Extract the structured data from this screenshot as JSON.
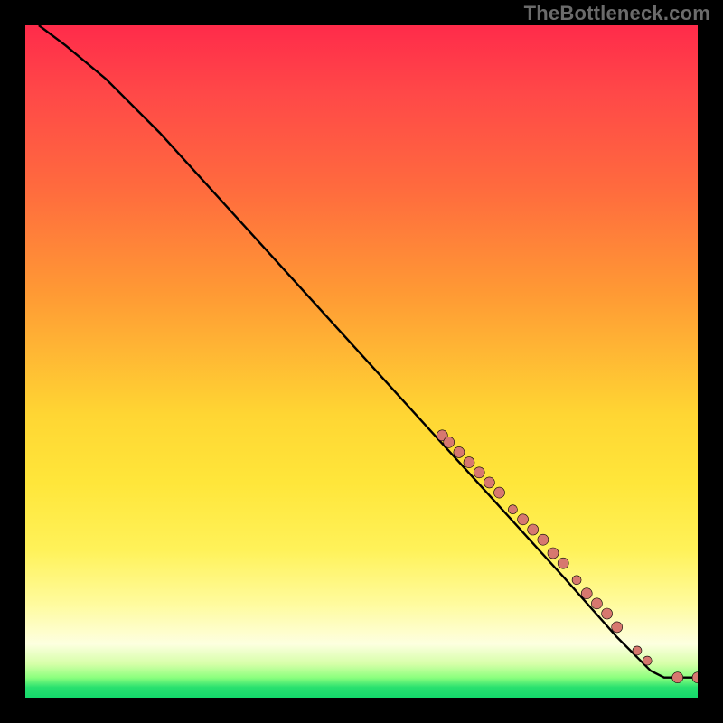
{
  "watermark": "TheBottleneck.com",
  "chart_data": {
    "type": "line",
    "title": "",
    "xlabel": "",
    "ylabel": "",
    "xlim": [
      0,
      100
    ],
    "ylim": [
      0,
      100
    ],
    "curve": [
      {
        "x": 2,
        "y": 100
      },
      {
        "x": 6,
        "y": 97
      },
      {
        "x": 12,
        "y": 92
      },
      {
        "x": 20,
        "y": 84
      },
      {
        "x": 30,
        "y": 73
      },
      {
        "x": 40,
        "y": 62
      },
      {
        "x": 50,
        "y": 51
      },
      {
        "x": 60,
        "y": 40
      },
      {
        "x": 70,
        "y": 29
      },
      {
        "x": 80,
        "y": 18
      },
      {
        "x": 88,
        "y": 9
      },
      {
        "x": 93,
        "y": 4
      },
      {
        "x": 95,
        "y": 3
      },
      {
        "x": 100,
        "y": 3
      }
    ],
    "points": [
      {
        "x": 62,
        "y": 39,
        "r": 6
      },
      {
        "x": 63,
        "y": 38,
        "r": 6
      },
      {
        "x": 64.5,
        "y": 36.5,
        "r": 6
      },
      {
        "x": 66,
        "y": 35,
        "r": 6
      },
      {
        "x": 67.5,
        "y": 33.5,
        "r": 6
      },
      {
        "x": 69,
        "y": 32,
        "r": 6
      },
      {
        "x": 70.5,
        "y": 30.5,
        "r": 6
      },
      {
        "x": 72.5,
        "y": 28,
        "r": 5
      },
      {
        "x": 74,
        "y": 26.5,
        "r": 6
      },
      {
        "x": 75.5,
        "y": 25,
        "r": 6
      },
      {
        "x": 77,
        "y": 23.5,
        "r": 6
      },
      {
        "x": 78.5,
        "y": 21.5,
        "r": 6
      },
      {
        "x": 80,
        "y": 20,
        "r": 6
      },
      {
        "x": 82,
        "y": 17.5,
        "r": 5
      },
      {
        "x": 83.5,
        "y": 15.5,
        "r": 6
      },
      {
        "x": 85,
        "y": 14,
        "r": 6
      },
      {
        "x": 86.5,
        "y": 12.5,
        "r": 6
      },
      {
        "x": 88,
        "y": 10.5,
        "r": 6
      },
      {
        "x": 91,
        "y": 7,
        "r": 5
      },
      {
        "x": 92.5,
        "y": 5.5,
        "r": 5
      },
      {
        "x": 97,
        "y": 3,
        "r": 6
      },
      {
        "x": 100,
        "y": 3,
        "r": 6
      }
    ],
    "colors": {
      "curve": "#000000",
      "point": "#d7786f",
      "gradient_top": "#ff2b4a",
      "gradient_mid": "#ffe63a",
      "gradient_bottom": "#14d96b"
    }
  }
}
